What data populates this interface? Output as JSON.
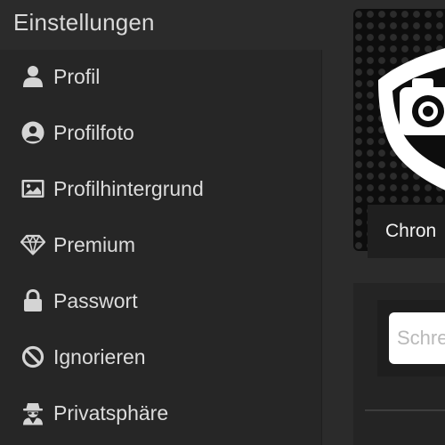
{
  "page": {
    "title": "Einstellungen"
  },
  "sidebar": {
    "items": [
      {
        "label": "Profil",
        "icon": "user-icon"
      },
      {
        "label": "Profilfoto",
        "icon": "user-circle-icon"
      },
      {
        "label": "Profilhintergrund",
        "icon": "image-icon"
      },
      {
        "label": "Premium",
        "icon": "diamond-icon"
      },
      {
        "label": "Passwort",
        "icon": "lock-icon"
      },
      {
        "label": "Ignorieren",
        "icon": "ban-icon"
      },
      {
        "label": "Privatsphäre",
        "icon": "user-secret-icon"
      }
    ]
  },
  "main": {
    "tab_label": "Chron",
    "search_placeholder": "Schre"
  },
  "colors": {
    "background": "#2b2b2b",
    "sidebar": "#262626",
    "text": "#dcdcdc",
    "icon": "#d4d4d4",
    "input": "#ffffff"
  }
}
